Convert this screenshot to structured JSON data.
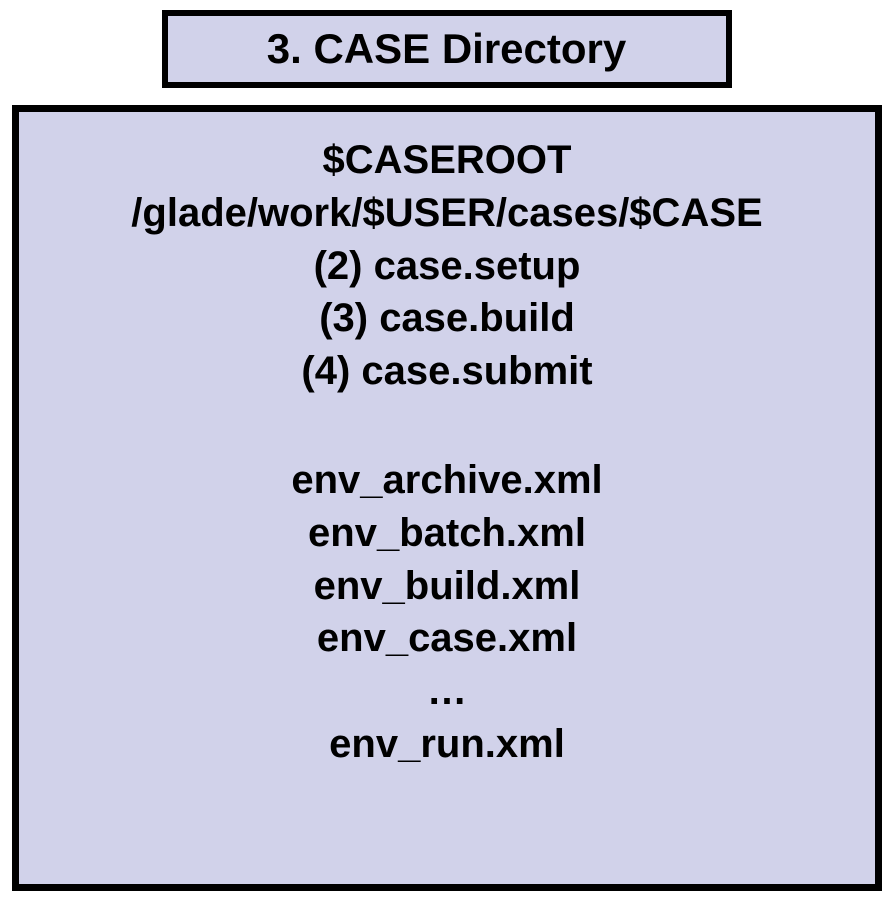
{
  "title": "3. CASE Directory",
  "caseroot_label": "$CASEROOT",
  "caseroot_path": "/glade/work/$USER/cases/$CASE",
  "steps": [
    "(2) case.setup",
    "(3) case.build",
    "(4) case.submit"
  ],
  "env_files": [
    "env_archive.xml",
    "env_batch.xml",
    "env_build.xml",
    "env_case.xml",
    "…",
    "env_run.xml"
  ]
}
